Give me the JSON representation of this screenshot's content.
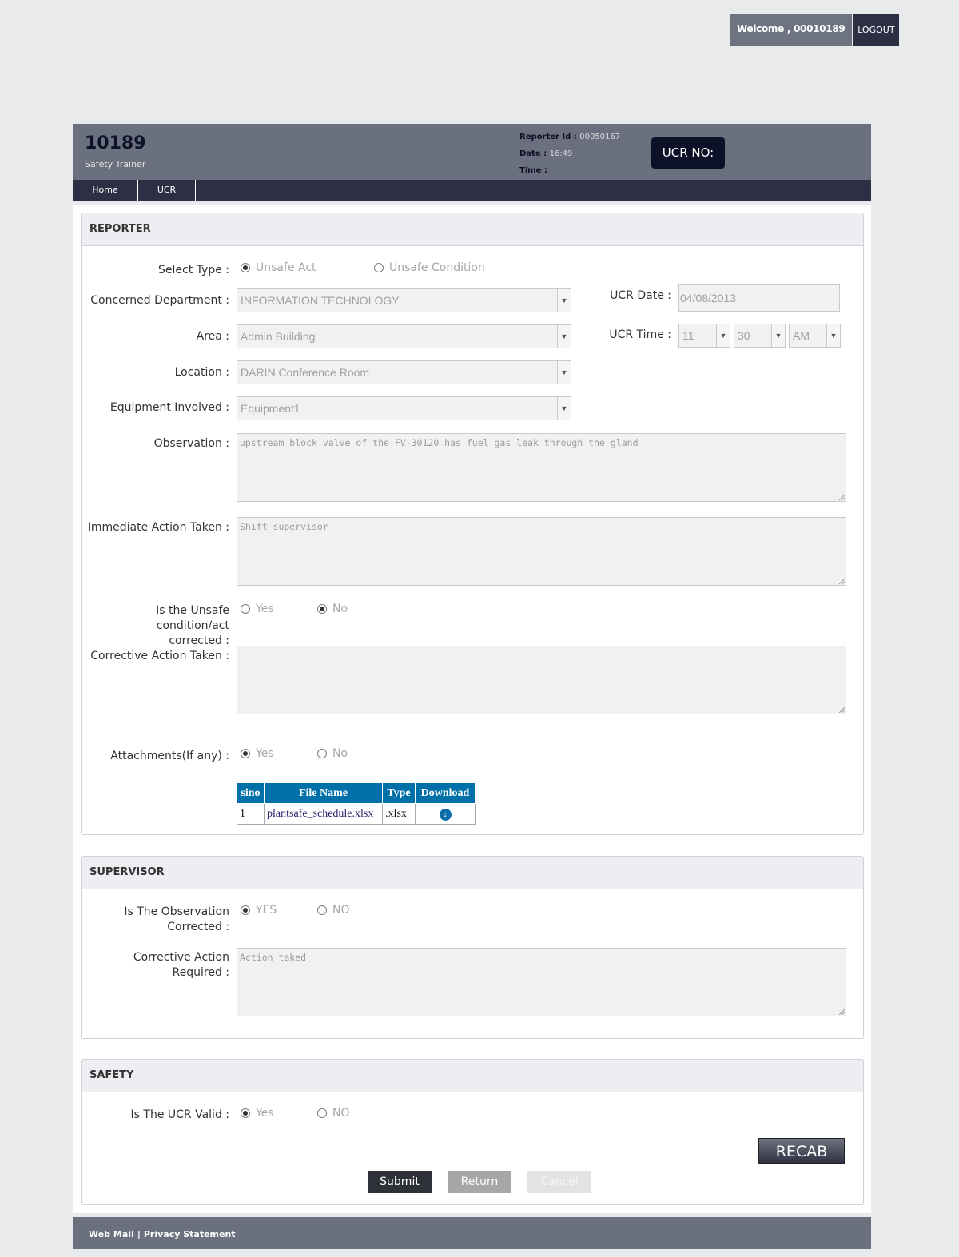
{
  "userbar": {
    "welcome": "Welcome , 00010189",
    "logout": "LOGOUT"
  },
  "header": {
    "emp_id": "10189",
    "role": "Safety Trainer",
    "reporter_label": "Reporter Id : ",
    "reporter_value": "00050167",
    "date_label": "Date : ",
    "date_value": "16:49",
    "time_label": "Time : ",
    "ucr_no": "UCR NO:"
  },
  "nav": {
    "home": "Home",
    "ucr": "UCR"
  },
  "reporter": {
    "title": "REPORTER",
    "select_type_label": "Select Type :",
    "type_options": [
      {
        "label": "Unsafe Act",
        "checked": true
      },
      {
        "label": "Unsafe Condition",
        "checked": false
      }
    ],
    "dept_label": "Concerned Department :",
    "dept_value": "INFORMATION TECHNOLOGY",
    "area_label": "Area :",
    "area_value": "Admin Building",
    "location_label": "Location :",
    "location_value": "DARIN Conference Room",
    "equipment_label": "Equipment Involved :",
    "equipment_value": "Equipment1",
    "ucr_date_label": "UCR Date :",
    "ucr_date_value": "04/08/2013",
    "ucr_time_label": "UCR Time :",
    "ucr_hour": "11",
    "ucr_minute": "30",
    "ucr_ampm": "AM",
    "observation_label": "Observation :",
    "observation_value": "upstream block valve of the FV-30120 has fuel gas leak through the gland",
    "immediate_label": "Immediate Action Taken :",
    "immediate_value": "Shift supervisor",
    "corrected_label_1": "Is the Unsafe condition/act",
    "corrected_label_2": "corrected :",
    "corrected_options": [
      {
        "label": "Yes",
        "checked": false
      },
      {
        "label": "No",
        "checked": true
      }
    ],
    "corrective_label": "Corrective Action Taken :",
    "corrective_value": "",
    "attach_label": "Attachments(If any) :",
    "attach_options": [
      {
        "label": "Yes",
        "checked": true
      },
      {
        "label": "No",
        "checked": false
      }
    ],
    "attach_table": {
      "headers": [
        "sino",
        "File Name",
        "Type",
        "Download"
      ],
      "rows": [
        {
          "sino": "1",
          "file": "plantsafe_schedule.xlsx",
          "type": ".xlsx",
          "download_icon": "download-circle-icon"
        }
      ]
    }
  },
  "supervisor": {
    "title": "SUPERVISOR",
    "obs_label_1": "Is The Observation",
    "obs_label_2": "Corrected :",
    "obs_options": [
      {
        "label": "YES",
        "checked": true
      },
      {
        "label": "NO",
        "checked": false
      }
    ],
    "req_label": "Corrective Action Required :",
    "req_value": "Action taked"
  },
  "safety": {
    "title": "SAFETY",
    "valid_label": "Is The UCR Valid :",
    "valid_options": [
      {
        "label": "Yes",
        "checked": true
      },
      {
        "label": "NO",
        "checked": false
      }
    ],
    "recab": "RECAB"
  },
  "buttons": {
    "submit": "Submit",
    "return": "Return",
    "cancel": "Cancel"
  },
  "footer": {
    "webmail": "Web Mail",
    "sep": "|",
    "privacy": "Privacy Statement"
  },
  "colors": {
    "header_bg": "#6b707e",
    "nav_bg": "#2d2f45",
    "table_head": "#0070a8",
    "page_bg": "#e8eaeb"
  }
}
